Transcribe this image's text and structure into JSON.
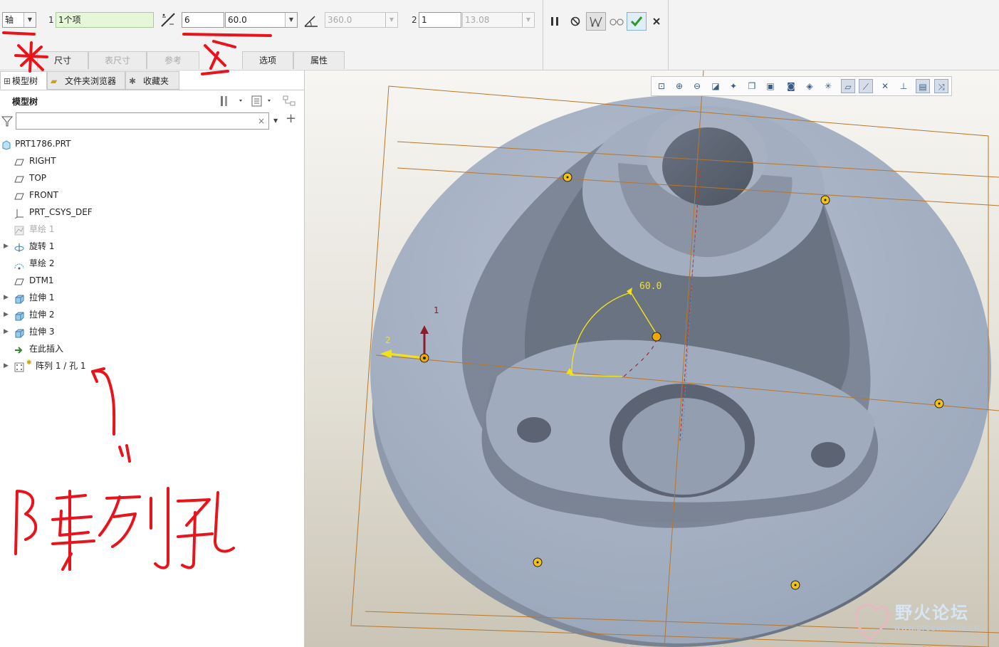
{
  "dashboard": {
    "type_select": "轴",
    "ref_index": "1",
    "ref_value": "1个项",
    "count1": "6",
    "angle_value": "60.0",
    "angle_range": "360.0",
    "dir2_index": "2",
    "count2": "1",
    "spacing2": "13.08",
    "tabs": [
      "尺寸",
      "表尺寸",
      "参考",
      "选项",
      "属性"
    ]
  },
  "panel": {
    "tabs": [
      "模型树",
      "文件夹浏览器",
      "收藏夹"
    ],
    "title": "模型树",
    "filter_placeholder": "",
    "filter_clear": "×",
    "add_glyph": "+"
  },
  "tree": [
    {
      "label": "PRT1786.PRT",
      "icon": "part-icon",
      "expand": false,
      "dim": false
    },
    {
      "label": "RIGHT",
      "icon": "datum-plane-icon",
      "expand": false,
      "dim": false
    },
    {
      "label": "TOP",
      "icon": "datum-plane-icon",
      "expand": false,
      "dim": false
    },
    {
      "label": "FRONT",
      "icon": "datum-plane-icon",
      "expand": false,
      "dim": false
    },
    {
      "label": "PRT_CSYS_DEF",
      "icon": "csys-icon",
      "expand": false,
      "dim": false
    },
    {
      "label": "草绘 1",
      "icon": "sketch-icon",
      "expand": false,
      "dim": true
    },
    {
      "label": "旋转 1",
      "icon": "revolve-icon",
      "expand": true,
      "dim": false
    },
    {
      "label": "草绘 2",
      "icon": "sketch-icon",
      "expand": false,
      "dim": false
    },
    {
      "label": "DTM1",
      "icon": "datum-plane-icon",
      "expand": false,
      "dim": false
    },
    {
      "label": "拉伸 1",
      "icon": "extrude-icon",
      "expand": true,
      "dim": false
    },
    {
      "label": "拉伸 2",
      "icon": "extrude-icon",
      "expand": true,
      "dim": false
    },
    {
      "label": "拉伸 3",
      "icon": "extrude-icon",
      "expand": true,
      "dim": false
    },
    {
      "label": "在此插入",
      "icon": "insert-here-icon",
      "expand": false,
      "dim": false
    },
    {
      "label": "阵列 1 / 孔 1",
      "icon": "pattern-icon",
      "expand": true,
      "dim": false
    }
  ],
  "viewport": {
    "angle_dim": "60.0",
    "dir1_label": "1",
    "dir2_label": "2"
  },
  "annotations": {
    "handwritten": "阵列孔"
  },
  "watermark": {
    "title": "野火论坛",
    "url": "www.proewildfire.cn"
  },
  "colors": {
    "part": "#a3afc2",
    "confirm": "#2a9a2a",
    "markup": "#e8141c",
    "sketch": "#f2e21a",
    "datum": "#b7772b"
  }
}
